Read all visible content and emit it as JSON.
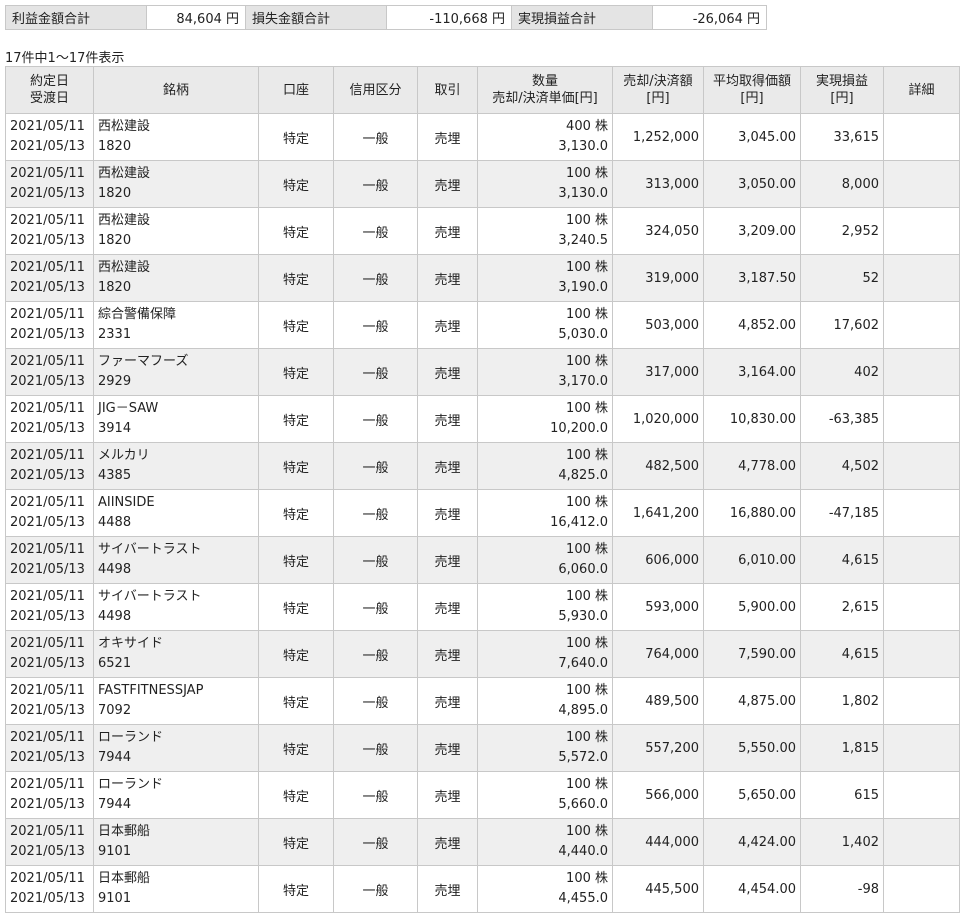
{
  "summary": {
    "profit_label": "利益金額合計",
    "profit_value": "84,604 円",
    "loss_label": "損失金額合計",
    "loss_value": "-110,668 円",
    "realized_label": "実現損益合計",
    "realized_value": "-26,064 円"
  },
  "count_text": "17件中1～17件表示",
  "headers": {
    "date_top": "約定日",
    "date_bottom": "受渡日",
    "name": "銘柄",
    "account": "口座",
    "credit": "信用区分",
    "trade": "取引",
    "qty_top": "数量",
    "qty_bottom": "売却/決済単価[円]",
    "amount_top": "売却/決済額",
    "amount_bottom": "[円]",
    "avg_top": "平均取得価額",
    "avg_bottom": "[円]",
    "pl_top": "実現損益",
    "pl_bottom": "[円]",
    "detail": "詳細"
  },
  "rows": [
    {
      "trade_date": "2021/05/11",
      "settle_date": "2021/05/13",
      "name": "西松建設",
      "code": "1820",
      "account": "特定",
      "credit": "一般",
      "trade": "売埋",
      "qty": "400 株",
      "price": "3,130.0",
      "amount": "1,252,000",
      "avg": "3,045.00",
      "pl": "33,615"
    },
    {
      "trade_date": "2021/05/11",
      "settle_date": "2021/05/13",
      "name": "西松建設",
      "code": "1820",
      "account": "特定",
      "credit": "一般",
      "trade": "売埋",
      "qty": "100 株",
      "price": "3,130.0",
      "amount": "313,000",
      "avg": "3,050.00",
      "pl": "8,000"
    },
    {
      "trade_date": "2021/05/11",
      "settle_date": "2021/05/13",
      "name": "西松建設",
      "code": "1820",
      "account": "特定",
      "credit": "一般",
      "trade": "売埋",
      "qty": "100 株",
      "price": "3,240.5",
      "amount": "324,050",
      "avg": "3,209.00",
      "pl": "2,952"
    },
    {
      "trade_date": "2021/05/11",
      "settle_date": "2021/05/13",
      "name": "西松建設",
      "code": "1820",
      "account": "特定",
      "credit": "一般",
      "trade": "売埋",
      "qty": "100 株",
      "price": "3,190.0",
      "amount": "319,000",
      "avg": "3,187.50",
      "pl": "52"
    },
    {
      "trade_date": "2021/05/11",
      "settle_date": "2021/05/13",
      "name": "綜合警備保障",
      "code": "2331",
      "account": "特定",
      "credit": "一般",
      "trade": "売埋",
      "qty": "100 株",
      "price": "5,030.0",
      "amount": "503,000",
      "avg": "4,852.00",
      "pl": "17,602"
    },
    {
      "trade_date": "2021/05/11",
      "settle_date": "2021/05/13",
      "name": "ファーマフーズ",
      "code": "2929",
      "account": "特定",
      "credit": "一般",
      "trade": "売埋",
      "qty": "100 株",
      "price": "3,170.0",
      "amount": "317,000",
      "avg": "3,164.00",
      "pl": "402"
    },
    {
      "trade_date": "2021/05/11",
      "settle_date": "2021/05/13",
      "name": "JIG－SAW",
      "code": "3914",
      "account": "特定",
      "credit": "一般",
      "trade": "売埋",
      "qty": "100 株",
      "price": "10,200.0",
      "amount": "1,020,000",
      "avg": "10,830.00",
      "pl": "-63,385"
    },
    {
      "trade_date": "2021/05/11",
      "settle_date": "2021/05/13",
      "name": "メルカリ",
      "code": "4385",
      "account": "特定",
      "credit": "一般",
      "trade": "売埋",
      "qty": "100 株",
      "price": "4,825.0",
      "amount": "482,500",
      "avg": "4,778.00",
      "pl": "4,502"
    },
    {
      "trade_date": "2021/05/11",
      "settle_date": "2021/05/13",
      "name": "AIINSIDE",
      "code": "4488",
      "account": "特定",
      "credit": "一般",
      "trade": "売埋",
      "qty": "100 株",
      "price": "16,412.0",
      "amount": "1,641,200",
      "avg": "16,880.00",
      "pl": "-47,185"
    },
    {
      "trade_date": "2021/05/11",
      "settle_date": "2021/05/13",
      "name": "サイバートラスト",
      "code": "4498",
      "account": "特定",
      "credit": "一般",
      "trade": "売埋",
      "qty": "100 株",
      "price": "6,060.0",
      "amount": "606,000",
      "avg": "6,010.00",
      "pl": "4,615"
    },
    {
      "trade_date": "2021/05/11",
      "settle_date": "2021/05/13",
      "name": "サイバートラスト",
      "code": "4498",
      "account": "特定",
      "credit": "一般",
      "trade": "売埋",
      "qty": "100 株",
      "price": "5,930.0",
      "amount": "593,000",
      "avg": "5,900.00",
      "pl": "2,615"
    },
    {
      "trade_date": "2021/05/11",
      "settle_date": "2021/05/13",
      "name": "オキサイド",
      "code": "6521",
      "account": "特定",
      "credit": "一般",
      "trade": "売埋",
      "qty": "100 株",
      "price": "7,640.0",
      "amount": "764,000",
      "avg": "7,590.00",
      "pl": "4,615"
    },
    {
      "trade_date": "2021/05/11",
      "settle_date": "2021/05/13",
      "name": "FASTFITNESSJAP",
      "code": "7092",
      "account": "特定",
      "credit": "一般",
      "trade": "売埋",
      "qty": "100 株",
      "price": "4,895.0",
      "amount": "489,500",
      "avg": "4,875.00",
      "pl": "1,802"
    },
    {
      "trade_date": "2021/05/11",
      "settle_date": "2021/05/13",
      "name": "ローランド",
      "code": "7944",
      "account": "特定",
      "credit": "一般",
      "trade": "売埋",
      "qty": "100 株",
      "price": "5,572.0",
      "amount": "557,200",
      "avg": "5,550.00",
      "pl": "1,815"
    },
    {
      "trade_date": "2021/05/11",
      "settle_date": "2021/05/13",
      "name": "ローランド",
      "code": "7944",
      "account": "特定",
      "credit": "一般",
      "trade": "売埋",
      "qty": "100 株",
      "price": "5,660.0",
      "amount": "566,000",
      "avg": "5,650.00",
      "pl": "615"
    },
    {
      "trade_date": "2021/05/11",
      "settle_date": "2021/05/13",
      "name": "日本郵船",
      "code": "9101",
      "account": "特定",
      "credit": "一般",
      "trade": "売埋",
      "qty": "100 株",
      "price": "4,440.0",
      "amount": "444,000",
      "avg": "4,424.00",
      "pl": "1,402"
    },
    {
      "trade_date": "2021/05/11",
      "settle_date": "2021/05/13",
      "name": "日本郵船",
      "code": "9101",
      "account": "特定",
      "credit": "一般",
      "trade": "売埋",
      "qty": "100 株",
      "price": "4,455.0",
      "amount": "445,500",
      "avg": "4,454.00",
      "pl": "-98"
    }
  ]
}
